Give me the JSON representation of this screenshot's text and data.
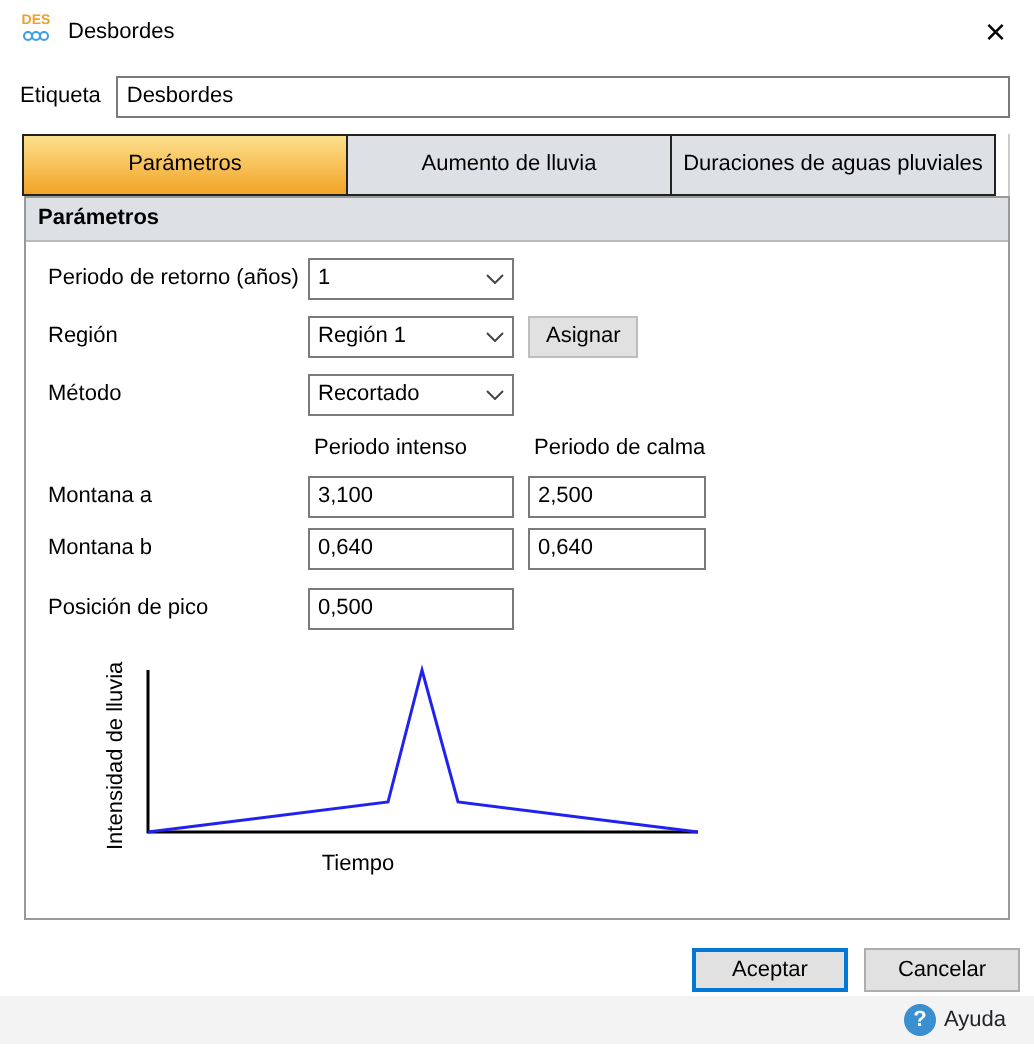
{
  "window": {
    "title": "Desbordes",
    "logo_text": "DES",
    "close_glyph": "×"
  },
  "label_field": {
    "label": "Etiqueta",
    "value": "Desbordes"
  },
  "tabs": [
    {
      "label": "Parámetros",
      "selected": true
    },
    {
      "label": "Aumento de lluvia",
      "selected": false
    },
    {
      "label": "Duraciones de aguas pluviales",
      "selected": false
    }
  ],
  "panel": {
    "title": "Parámetros",
    "dropdowns": [
      {
        "label": "Periodo de retorno (años)",
        "value": "1"
      },
      {
        "label": "Región",
        "value": "Región 1",
        "button": "Asignar"
      },
      {
        "label": "Método",
        "value": "Recortado"
      }
    ],
    "columns": [
      "Periodo intenso",
      "Periodo de calma"
    ],
    "rows": [
      {
        "label": "Montana a",
        "values": [
          "3,100",
          "2,500"
        ]
      },
      {
        "label": "Montana b",
        "values": [
          "0,640",
          "0,640"
        ]
      }
    ],
    "peak": {
      "label": "Posición de pico",
      "value": "0,500"
    },
    "chart": {
      "kind": "picture",
      "ylabel": "Intensidad de lluvia",
      "xlabel": "Tiempo"
    }
  },
  "buttons": [
    {
      "label": "Aceptar",
      "default": true
    },
    {
      "label": "Cancelar",
      "default": false
    }
  ],
  "help": {
    "glyph": "?",
    "label": "Ayuda"
  }
}
